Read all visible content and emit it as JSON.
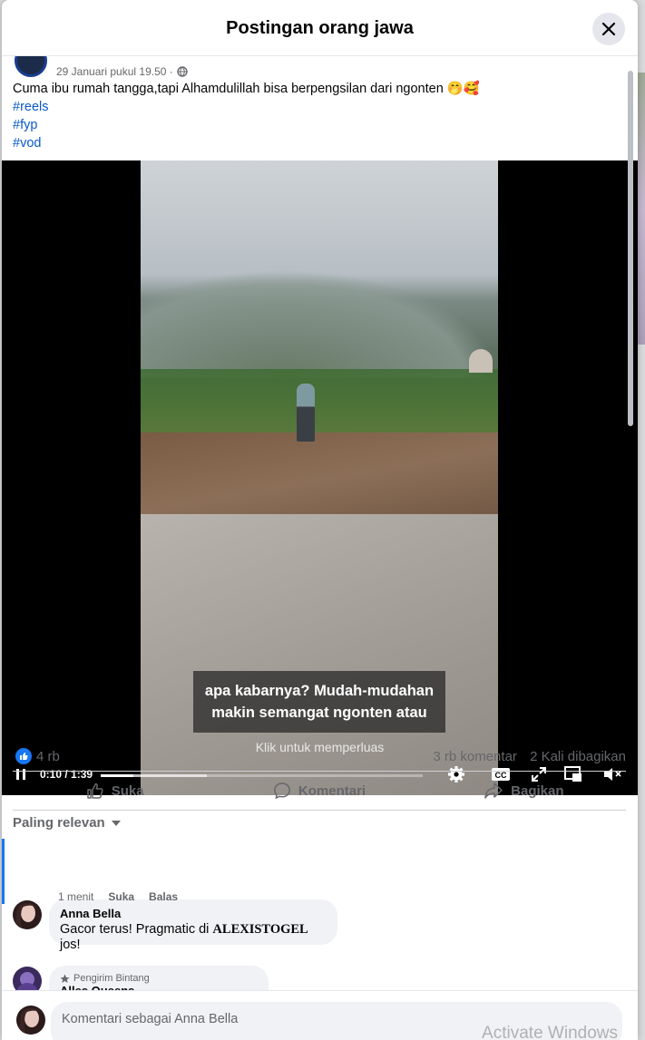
{
  "modal": {
    "title": "Postingan orang jawa",
    "close_icon": "close-icon"
  },
  "post": {
    "date": "29 Januari pukul 19.50 ·",
    "caption": "Cuma ibu rumah tangga,tapi Alhamdulillah bisa berpengsilan dari ngonten 🤭🥰",
    "hashtags": [
      "#reels",
      "#fyp",
      "#vod"
    ]
  },
  "video": {
    "subtitle_line1": "apa kabarnya? Mudah-mudahan",
    "subtitle_line2": "makin semangat ngonten atau",
    "expand_hint": "Klik untuk memperluas",
    "time": "0:10 / 1:39",
    "progress": 0.101,
    "buffered": 0.33
  },
  "stats": {
    "likes": "4 rb",
    "comments": "3 rb komentar",
    "shares": "2 Kali dibagikan"
  },
  "actions": {
    "like": "Suka",
    "comment": "Komentari",
    "share": "Bagikan"
  },
  "sort_label": "Paling relevan",
  "comments": [
    {
      "name": "Anna Bella",
      "text_before": "Gacor terus! Pragmatic di ",
      "text_bold": "ALEXISTOGEL",
      "text_after": " jos!",
      "time": "1 menit",
      "like": "Suka",
      "reply": "Balas"
    },
    {
      "badge": "Pengirim Bintang",
      "name": "Alles Queens"
    }
  ],
  "composer": {
    "placeholder": "Komentari sebagai Anna Bella"
  },
  "watermark": "Activate Windows",
  "colors": {
    "accent": "#1877f2",
    "link": "#0a58ca"
  }
}
